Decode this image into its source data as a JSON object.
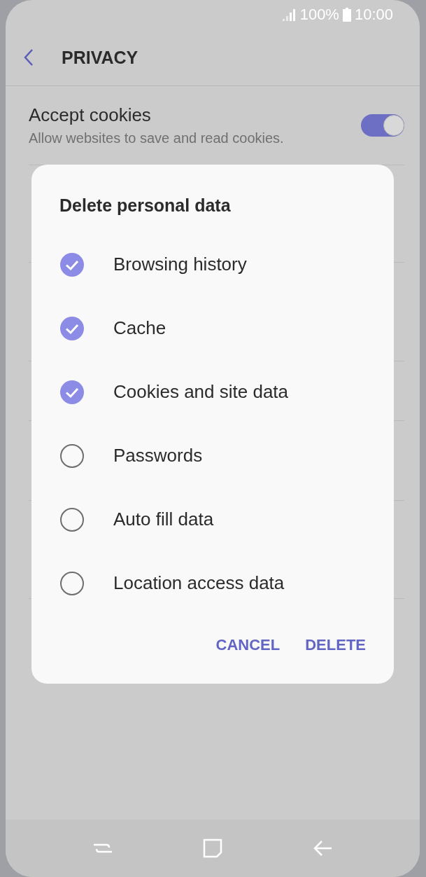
{
  "status_bar": {
    "battery": "100%",
    "time": "10:00"
  },
  "header": {
    "title": "PRIVACY"
  },
  "settings": [
    {
      "title": "Accept cookies",
      "subtitle": "Allow websites to save and read cookies.",
      "on": true
    }
  ],
  "dialog": {
    "title": "Delete personal data",
    "options": [
      {
        "label": "Browsing history",
        "checked": true
      },
      {
        "label": "Cache",
        "checked": true
      },
      {
        "label": "Cookies and site data",
        "checked": true
      },
      {
        "label": "Passwords",
        "checked": false
      },
      {
        "label": "Auto fill data",
        "checked": false
      },
      {
        "label": "Location access data",
        "checked": false
      }
    ],
    "buttons": [
      "CANCEL",
      "DELETE"
    ]
  }
}
